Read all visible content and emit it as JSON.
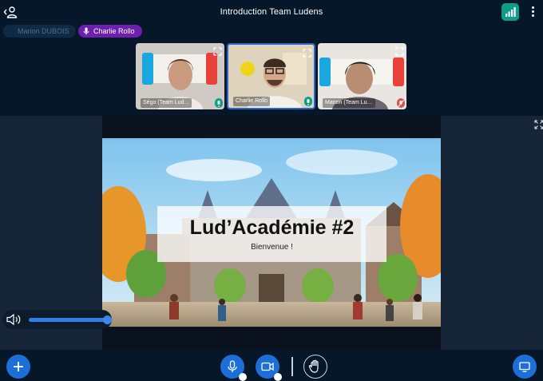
{
  "window": {
    "title": "Introduction Team Ludens"
  },
  "talking": {
    "idle_name": "Marion DUBOIS",
    "active_name": "Charlie Rollo"
  },
  "webcams": [
    {
      "name": "Ségo (Team Lud…",
      "active": false,
      "mic_color": "#0f9d88"
    },
    {
      "name": "Charlie Rollo",
      "active": true,
      "mic_color": "#0f9d88"
    },
    {
      "name": "Manon (Team Lu…",
      "active": false,
      "mic_color": "#d9534f"
    }
  ],
  "presentation": {
    "title": "Lud’Académie #2",
    "subtitle": "Bienvenue !"
  },
  "volume": {
    "level": 0.97
  },
  "icons": {
    "users_toggle": "user-list-icon",
    "connection": "signal-bars-icon",
    "options": "kebab-menu-icon",
    "fullscreen": "expand-icon",
    "volume": "speaker-icon",
    "actions": "plus-icon",
    "mic": "microphone-icon",
    "camera": "video-camera-icon",
    "raise_hand": "hand-icon",
    "screen_share": "monitor-icon"
  },
  "colors": {
    "background": "#06172a",
    "accent_blue": "#1d6fd8",
    "talker_active": "#6f1fb0",
    "connection_ok": "#0f9d88"
  }
}
